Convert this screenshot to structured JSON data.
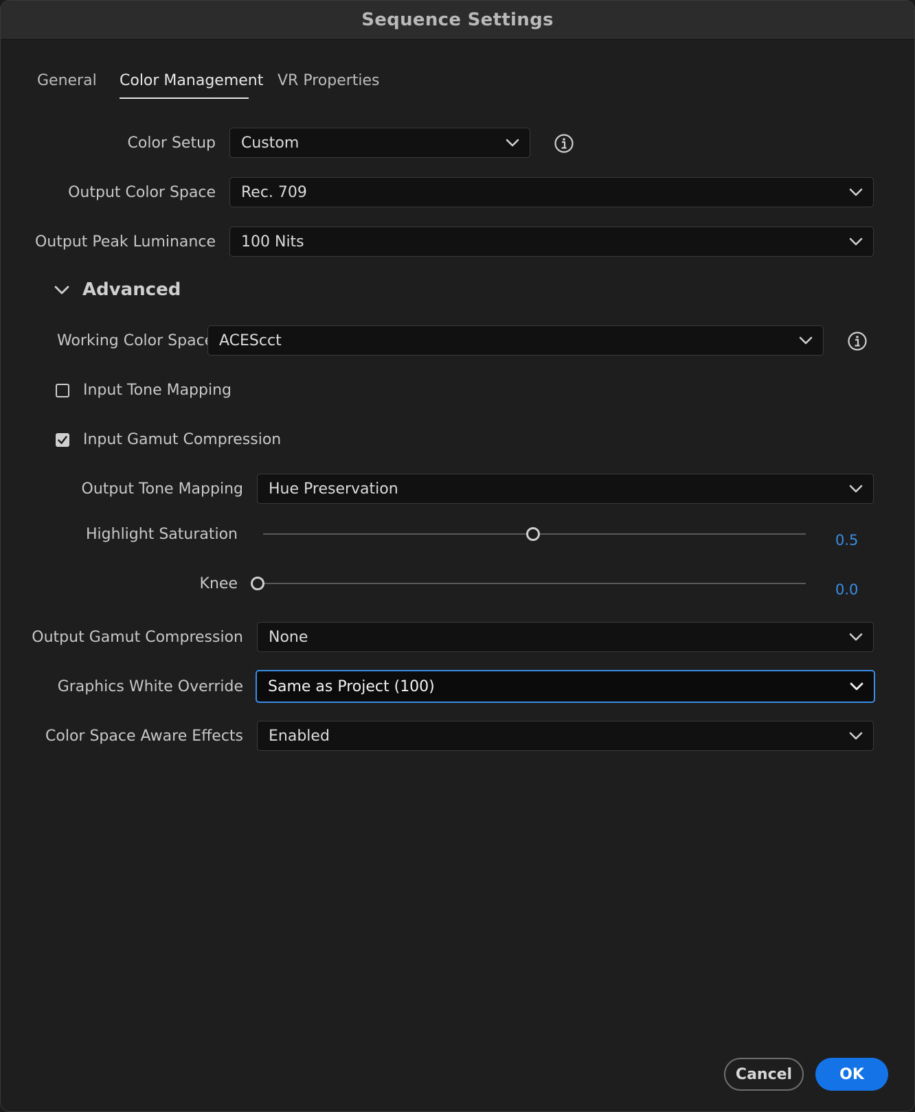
{
  "window": {
    "title": "Sequence Settings"
  },
  "tabs": [
    {
      "label": "General",
      "active": false
    },
    {
      "label": "Color Management",
      "active": true
    },
    {
      "label": "VR Properties",
      "active": false
    }
  ],
  "fields": {
    "color_setup": {
      "label": "Color Setup",
      "value": "Custom"
    },
    "output_color_space": {
      "label": "Output Color Space",
      "value": "Rec. 709"
    },
    "output_peak_luminance": {
      "label": "Output Peak Luminance",
      "value": "100 Nits"
    }
  },
  "advanced": {
    "label": "Advanced",
    "working_color_space": {
      "label": "Working Color Space",
      "value": "ACEScct"
    },
    "input_tone_mapping": {
      "label": "Input Tone Mapping",
      "checked": false
    },
    "input_gamut_compression": {
      "label": "Input Gamut Compression",
      "checked": true
    },
    "output_tone_mapping": {
      "label": "Output Tone Mapping",
      "value": "Hue Preservation"
    },
    "highlight_saturation": {
      "label": "Highlight Saturation",
      "value": "0.5",
      "fraction": 0.5
    },
    "knee": {
      "label": "Knee",
      "value": "0.0",
      "fraction": 0.0
    },
    "output_gamut_compression": {
      "label": "Output Gamut Compression",
      "value": "None"
    },
    "graphics_white_override": {
      "label": "Graphics White Override",
      "value": "Same as Project (100)"
    },
    "color_space_aware_effects": {
      "label": "Color Space Aware Effects",
      "value": "Enabled"
    }
  },
  "buttons": {
    "cancel": "Cancel",
    "ok": "OK"
  },
  "icons": {
    "info": "info-icon",
    "dropdown": "chevron-down-icon",
    "collapse": "chevron-down-icon",
    "check": "checkmark-icon"
  },
  "colors": {
    "accent": "#1473e6",
    "focus": "#3a8ee6",
    "slider_value": "#3a8ee6"
  }
}
